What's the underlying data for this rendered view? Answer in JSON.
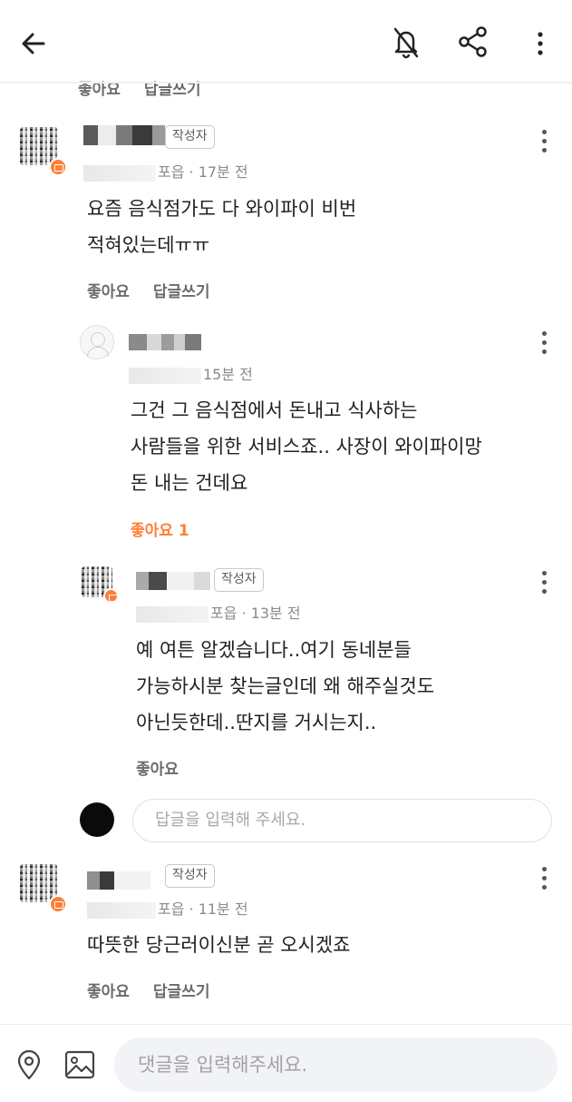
{
  "toolbar": {
    "back_icon": "arrow-left-icon",
    "mute_icon": "bell-off-icon",
    "share_icon": "share-icon",
    "more_icon": "more-vertical-icon"
  },
  "cut_actions": {
    "like": "좋아요",
    "reply": "답글쓰기"
  },
  "comments": [
    {
      "author_tag": "작성자",
      "meta": "포읍 · 17분 전",
      "lines": [
        "요즘 음식점가도 다 와이파이 비번",
        "적혀있는데ㅠㅠ"
      ],
      "like": "좋아요",
      "reply": "답글쓰기"
    },
    {
      "meta": "15분 전",
      "lines": [
        "그건 그 음식점에서 돈내고 식사하는",
        "사람들을 위한 서비스죠.. 사장이 와이파이망",
        "돈 내는 건데요"
      ],
      "like": "좋아요 1"
    },
    {
      "author_tag": "작성자",
      "meta": "포읍 · 13분 전",
      "lines": [
        "예 여튼 알겠습니다..여기 동네분들",
        "가능하시분 찾는글인데 왜 해주실것도",
        "아닌듯한데..딴지를 거시는지.."
      ],
      "like": "좋아요"
    },
    {
      "author_tag": "작성자",
      "meta": "포읍 · 11분 전",
      "lines": [
        "따뜻한 당근러이신분 곧 오시겠죠"
      ],
      "like": "좋아요",
      "reply": "답글쓰기"
    }
  ],
  "reply_input": {
    "placeholder": "답글을 입력해 주세요."
  },
  "bottom_bar": {
    "location_icon": "location-pin-icon",
    "image_icon": "image-icon",
    "placeholder": "댓글을 입력해주세요."
  },
  "colors": {
    "accent": "#ff7e36",
    "text": "#212124",
    "muted": "#8a8a8a"
  }
}
